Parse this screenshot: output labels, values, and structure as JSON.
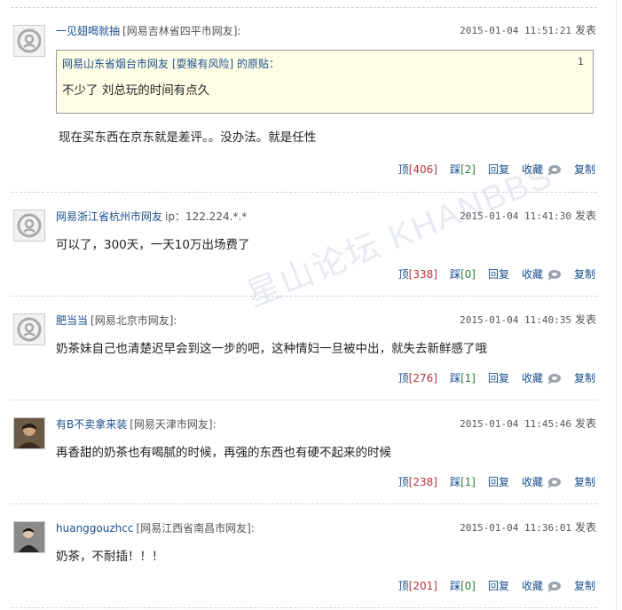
{
  "watermark": "星山论坛 KHANBBS",
  "actions_labels": {
    "up": "顶",
    "down": "踩",
    "reply": "回复",
    "collect": "收藏",
    "copy": "复制"
  },
  "posts": [
    {
      "user": "一见翅喝就抽",
      "location": "[网易吉林省四平市网友]:",
      "time": "2015-01-04 11:51:21",
      "publish": "发表",
      "quote": {
        "header": "网易山东省烟台市网友 [耍猴有风险] 的原贴：",
        "number": "1",
        "text": "不少了 刘总玩的时间有点久"
      },
      "content": "现在买东西在京东就是差评。。没办法。就是任性",
      "up": "[406]",
      "down": "[2]"
    },
    {
      "user": "网易浙江省杭州市网友",
      "location": "ip：122.224.*.*",
      "time": "2015-01-04 11:41:30",
      "publish": "发表",
      "content": "可以了，300天，一天10万出场费了",
      "up": "[338]",
      "down": "[0]"
    },
    {
      "user": "肥当当",
      "location": "[网易北京市网友]:",
      "time": "2015-01-04 11:40:35",
      "publish": "发表",
      "content": "奶茶妹自己也清楚迟早会到这一步的吧，这种情妇一旦被中出，就失去新鲜感了哦",
      "up": "[276]",
      "down": "[1]"
    },
    {
      "user": "有B不卖拿来装",
      "location": "[网易天津市网友]:",
      "time": "2015-01-04 11:45:46",
      "publish": "发表",
      "content": "再香甜的奶茶也有喝腻的时候，再强的东西也有硬不起来的时候",
      "up": "[238]",
      "down": "[1]"
    },
    {
      "user": "huanggouzhcc",
      "location": "[网易江西省南昌市网友]:",
      "time": "2015-01-04 11:36:01",
      "publish": "发表",
      "content": "奶茶，不耐插！！！",
      "up": "[201]",
      "down": "[0]"
    }
  ]
}
